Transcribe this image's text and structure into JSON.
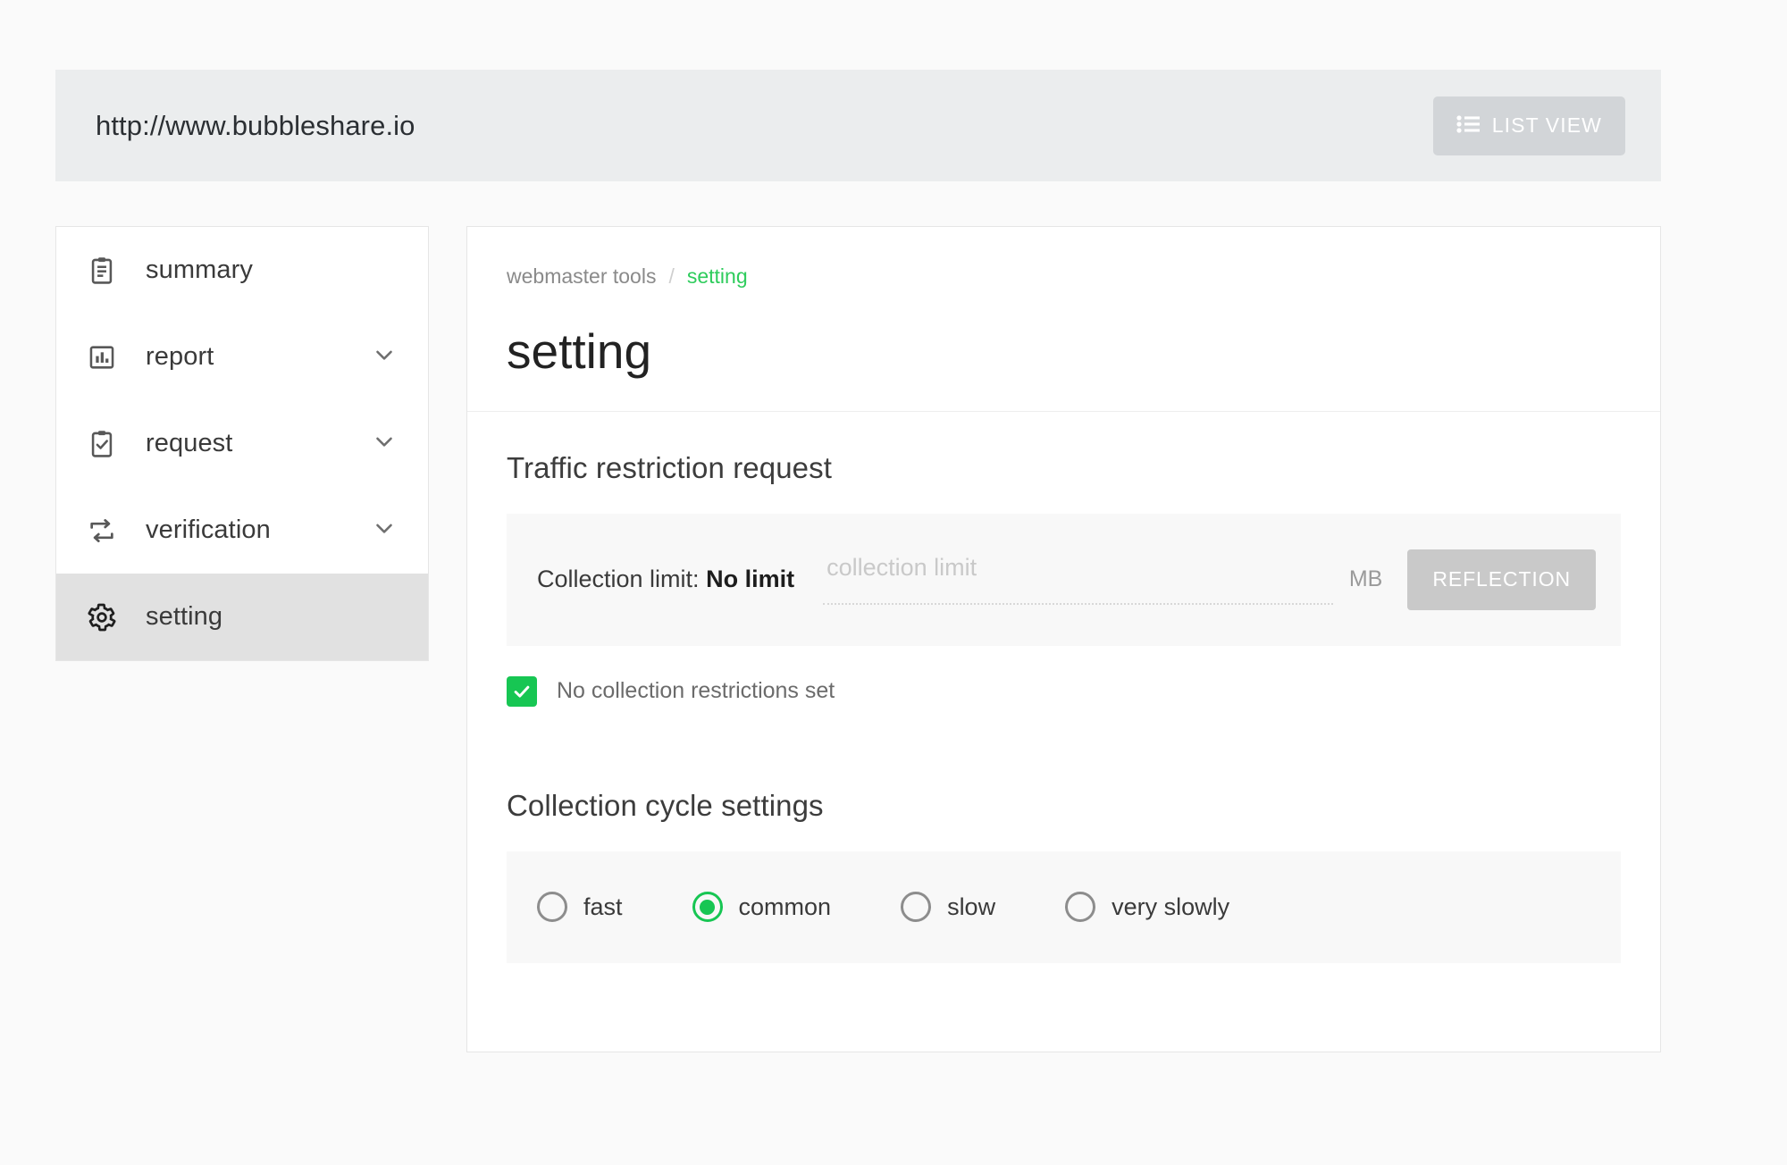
{
  "browser": {
    "url": "http://www.bubbleshare.io",
    "list_view_label": "LIST VIEW",
    "list_view_icon": "list-icon"
  },
  "sidebar": {
    "items": [
      {
        "label": "summary",
        "icon": "clipboard-text-icon",
        "expandable": false,
        "active": false
      },
      {
        "label": "report",
        "icon": "bar-chart-icon",
        "expandable": true,
        "active": false
      },
      {
        "label": "request",
        "icon": "clipboard-check-icon",
        "expandable": true,
        "active": false
      },
      {
        "label": "verification",
        "icon": "repeat-icon",
        "expandable": true,
        "active": false
      },
      {
        "label": "setting",
        "icon": "gear-icon",
        "expandable": false,
        "active": true
      }
    ]
  },
  "main": {
    "breadcrumb": {
      "parent": "webmaster tools",
      "separator": "/",
      "current": "setting"
    },
    "title": "setting",
    "traffic": {
      "section_title": "Traffic restriction request",
      "limit_label_prefix": "Collection limit:",
      "limit_value": "No limit",
      "input_value": "",
      "input_placeholder": "collection limit",
      "unit": "MB",
      "reflection_label": "REFLECTION",
      "checkbox_label": "No collection restrictions set",
      "checkbox_checked": true
    },
    "cycle": {
      "section_title": "Collection cycle settings",
      "options": [
        {
          "label": "fast",
          "selected": false
        },
        {
          "label": "common",
          "selected": true
        },
        {
          "label": "slow",
          "selected": false
        },
        {
          "label": "very slowly",
          "selected": false
        }
      ]
    }
  },
  "colors": {
    "accent_green": "#17c653",
    "header_bg": "#ebedee",
    "panel_bg": "#f8f8f8",
    "button_gray": "#c9c9c9",
    "active_nav": "#e1e1e1"
  }
}
